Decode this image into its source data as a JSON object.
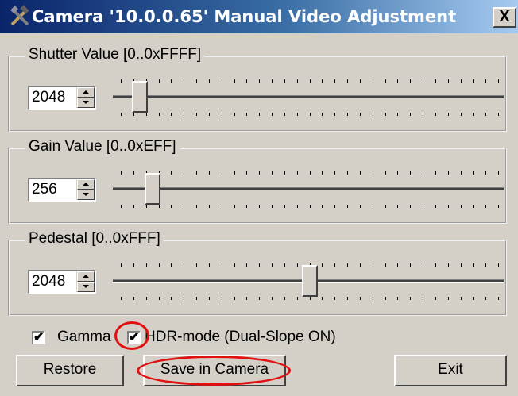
{
  "window": {
    "title": "Camera '10.0.0.65' Manual Video Adjustment",
    "close_label": "X"
  },
  "groups": [
    {
      "label": "Shutter Value [0..0xFFFF]",
      "value": "2048",
      "slider_position": 0.05
    },
    {
      "label": "Gain Value [0..0xEFF]",
      "value": "256",
      "slider_position": 0.085
    },
    {
      "label": "Pedestal [0..0xFFF]",
      "value": "2048",
      "slider_position": 0.5
    }
  ],
  "options": {
    "gamma_label": "Gamma",
    "gamma_checked": true,
    "hdr_label": "HDR-mode (Dual-Slope ON)",
    "hdr_checked": true,
    "check_glyph": "✔"
  },
  "buttons": {
    "restore": "Restore",
    "save": "Save in Camera",
    "exit": "Exit"
  },
  "colors": {
    "annotation": "#e01010",
    "titlebar_start": "#0a246a",
    "titlebar_end": "#a6caf0"
  }
}
